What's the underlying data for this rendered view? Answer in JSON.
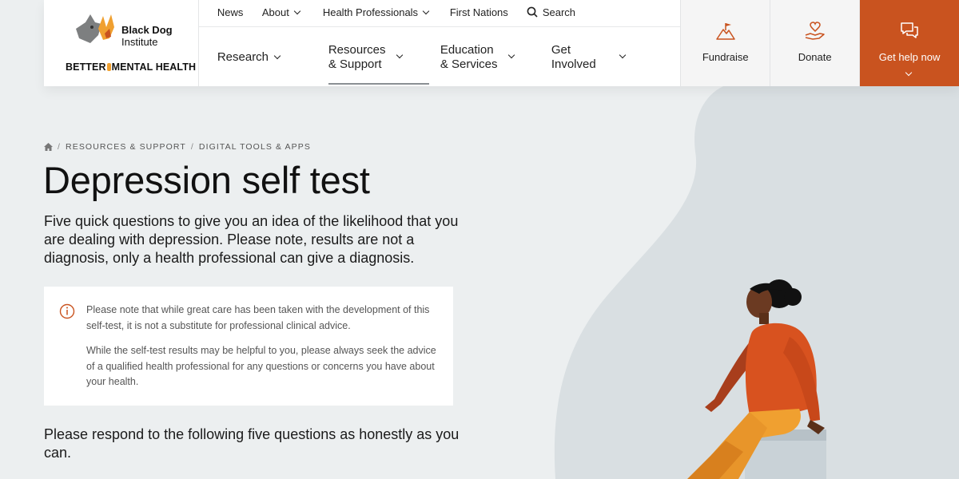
{
  "brand": {
    "name_bold": "Black Dog",
    "name_regular": "Institute",
    "tagline_left": "BETTER",
    "tagline_right": "MENTAL HEALTH"
  },
  "top_nav": {
    "items": [
      "News",
      "About",
      "Health Professionals",
      "First Nations"
    ],
    "search_label": "Search"
  },
  "main_nav": {
    "items": [
      {
        "line1": "Research",
        "line2": ""
      },
      {
        "line1": "Resources",
        "line2": "& Support"
      },
      {
        "line1": "Education",
        "line2": "& Services"
      },
      {
        "line1": "Get",
        "line2": "Involved"
      }
    ]
  },
  "actions": {
    "fundraise": "Fundraise",
    "donate": "Donate",
    "get_help": "Get help now"
  },
  "colors": {
    "accent": "#c9531f",
    "background": "#eceff0"
  },
  "breadcrumb": {
    "items": [
      "RESOURCES & SUPPORT",
      "DIGITAL TOOLS & APPS"
    ]
  },
  "page": {
    "title": "Depression self test",
    "intro": "Five quick questions to give you an idea of the likelihood that you are dealing with depression. Please note, results are not a diagnosis, only a health professional can give a diagnosis.",
    "notice_p1": "Please note that while great care has been taken with the development of this self-test, it is not a substitute for professional clinical advice.",
    "notice_p2": "While the self-test results may be helpful to you, please always seek the advice of a qualified health professional for any questions or concerns you have about your health.",
    "respond": "Please respond to the following five questions as honestly as you can."
  }
}
